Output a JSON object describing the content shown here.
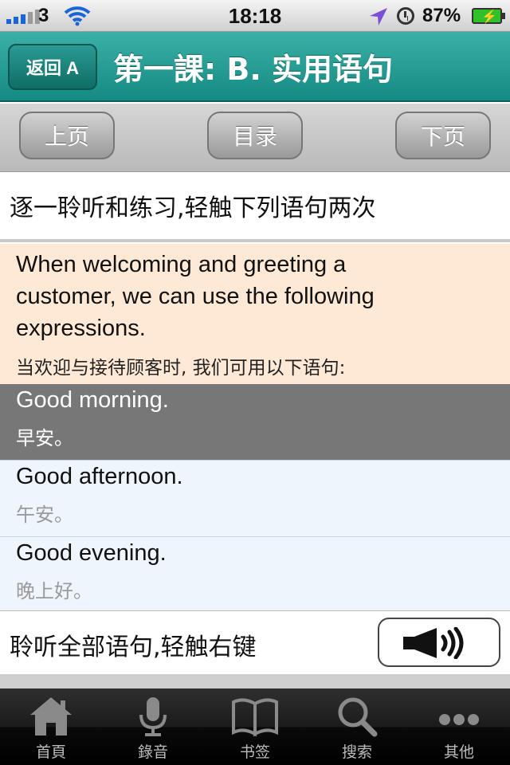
{
  "status_bar": {
    "carrier": "3",
    "time": "18:18",
    "battery_percent": "87%",
    "signal_bars_on": 3,
    "signal_bars_total": 5
  },
  "nav": {
    "back_label": "返回 A",
    "title": "第一課: B. 实用语句"
  },
  "toolbar": {
    "prev_label": "上页",
    "index_label": "目录",
    "next_label": "下页"
  },
  "instruction": "逐一聆听和练习,轻触下列语句两次",
  "intro": {
    "en_line1": "When welcoming and greeting a",
    "en_line2": "customer, we can use the following",
    "en_line3": "expressions.",
    "zh": "当欢迎与接待顾客时, 我们可用以下语句:"
  },
  "phrases": [
    {
      "en": "Good morning.",
      "zh": "早安。"
    },
    {
      "en": "Good afternoon.",
      "zh": "午安。"
    },
    {
      "en": "Good evening.",
      "zh": "晚上好。"
    }
  ],
  "listen_all": {
    "label": "聆听全部语句,轻触右键"
  },
  "tabs": [
    {
      "label": "首頁",
      "icon": "home-icon"
    },
    {
      "label": "錄音",
      "icon": "microphone-icon"
    },
    {
      "label": "书签",
      "icon": "book-icon"
    },
    {
      "label": "搜索",
      "icon": "search-icon"
    },
    {
      "label": "其他",
      "icon": "more-icon"
    }
  ],
  "colors": {
    "nav_teal": "#1f9a91",
    "intro_bg": "#fde9d6",
    "selected_row": "#777777",
    "phrase_bg": "#eef5fd"
  }
}
